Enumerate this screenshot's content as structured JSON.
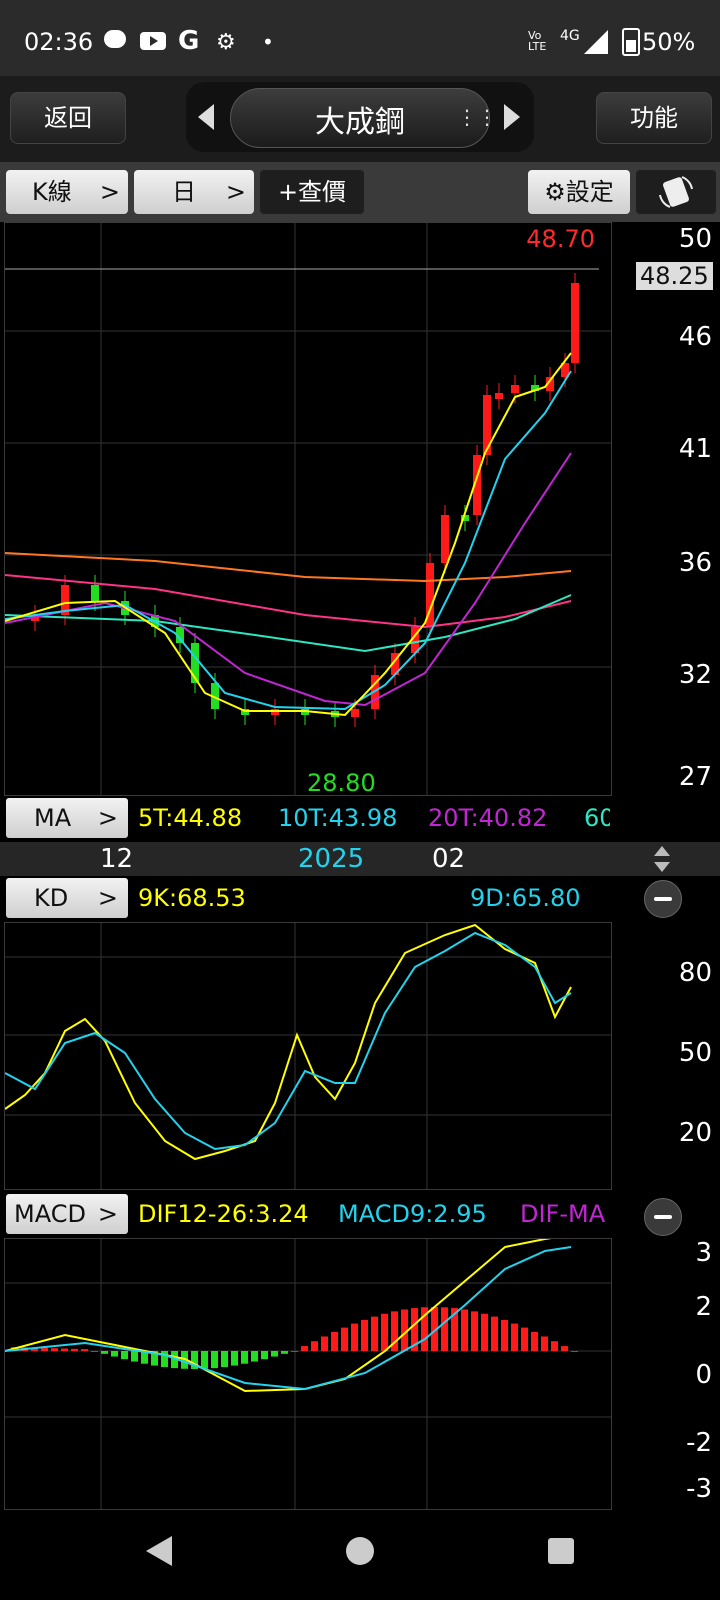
{
  "status": {
    "time": "02:36",
    "network": "4G",
    "volte": "Vo LTE",
    "battery": "50%"
  },
  "header": {
    "back_label": "返回",
    "title": "大成鋼",
    "function_label": "功能"
  },
  "toolbar": {
    "kline_label": "K線",
    "period_label": "日",
    "query_label": "+查價",
    "settings_label": "設定"
  },
  "price_chart": {
    "high_label": "48.70",
    "low_label": "28.80",
    "current_price": "48.25",
    "y_ticks": [
      "50",
      "46",
      "41",
      "36",
      "32",
      "27"
    ],
    "x_ticks": [
      "12",
      "2025",
      "02"
    ],
    "ma_label": "MA",
    "ma_values": [
      {
        "text": "5T:44.88",
        "color": "#ffff00"
      },
      {
        "text": "10T:43.98",
        "color": "#22d3ee"
      },
      {
        "text": "20T:40.82",
        "color": "#c026d3"
      },
      {
        "text": "60",
        "color": "#2ee6c0"
      }
    ]
  },
  "kd_chart": {
    "label": "KD",
    "k_text": "9K:68.53",
    "d_text": "9D:65.80",
    "y_ticks": [
      "80",
      "50",
      "20"
    ]
  },
  "macd_chart": {
    "label": "MACD",
    "dif_text": "DIF12-26:3.24",
    "macd_text": "MACD9:2.95",
    "diff_text": "DIF-MA",
    "y_ticks": [
      "3",
      "2",
      "0",
      "-2",
      "-3"
    ]
  },
  "colors": {
    "up": "#ff1a1a",
    "down": "#22dd22",
    "ma5": "#ffff00",
    "ma10": "#22d3ee",
    "ma20": "#c026d3",
    "ma60": "#2ee6c0",
    "ma_long_pink": "#ff3388",
    "ma_long_orange": "#ff7722"
  }
}
